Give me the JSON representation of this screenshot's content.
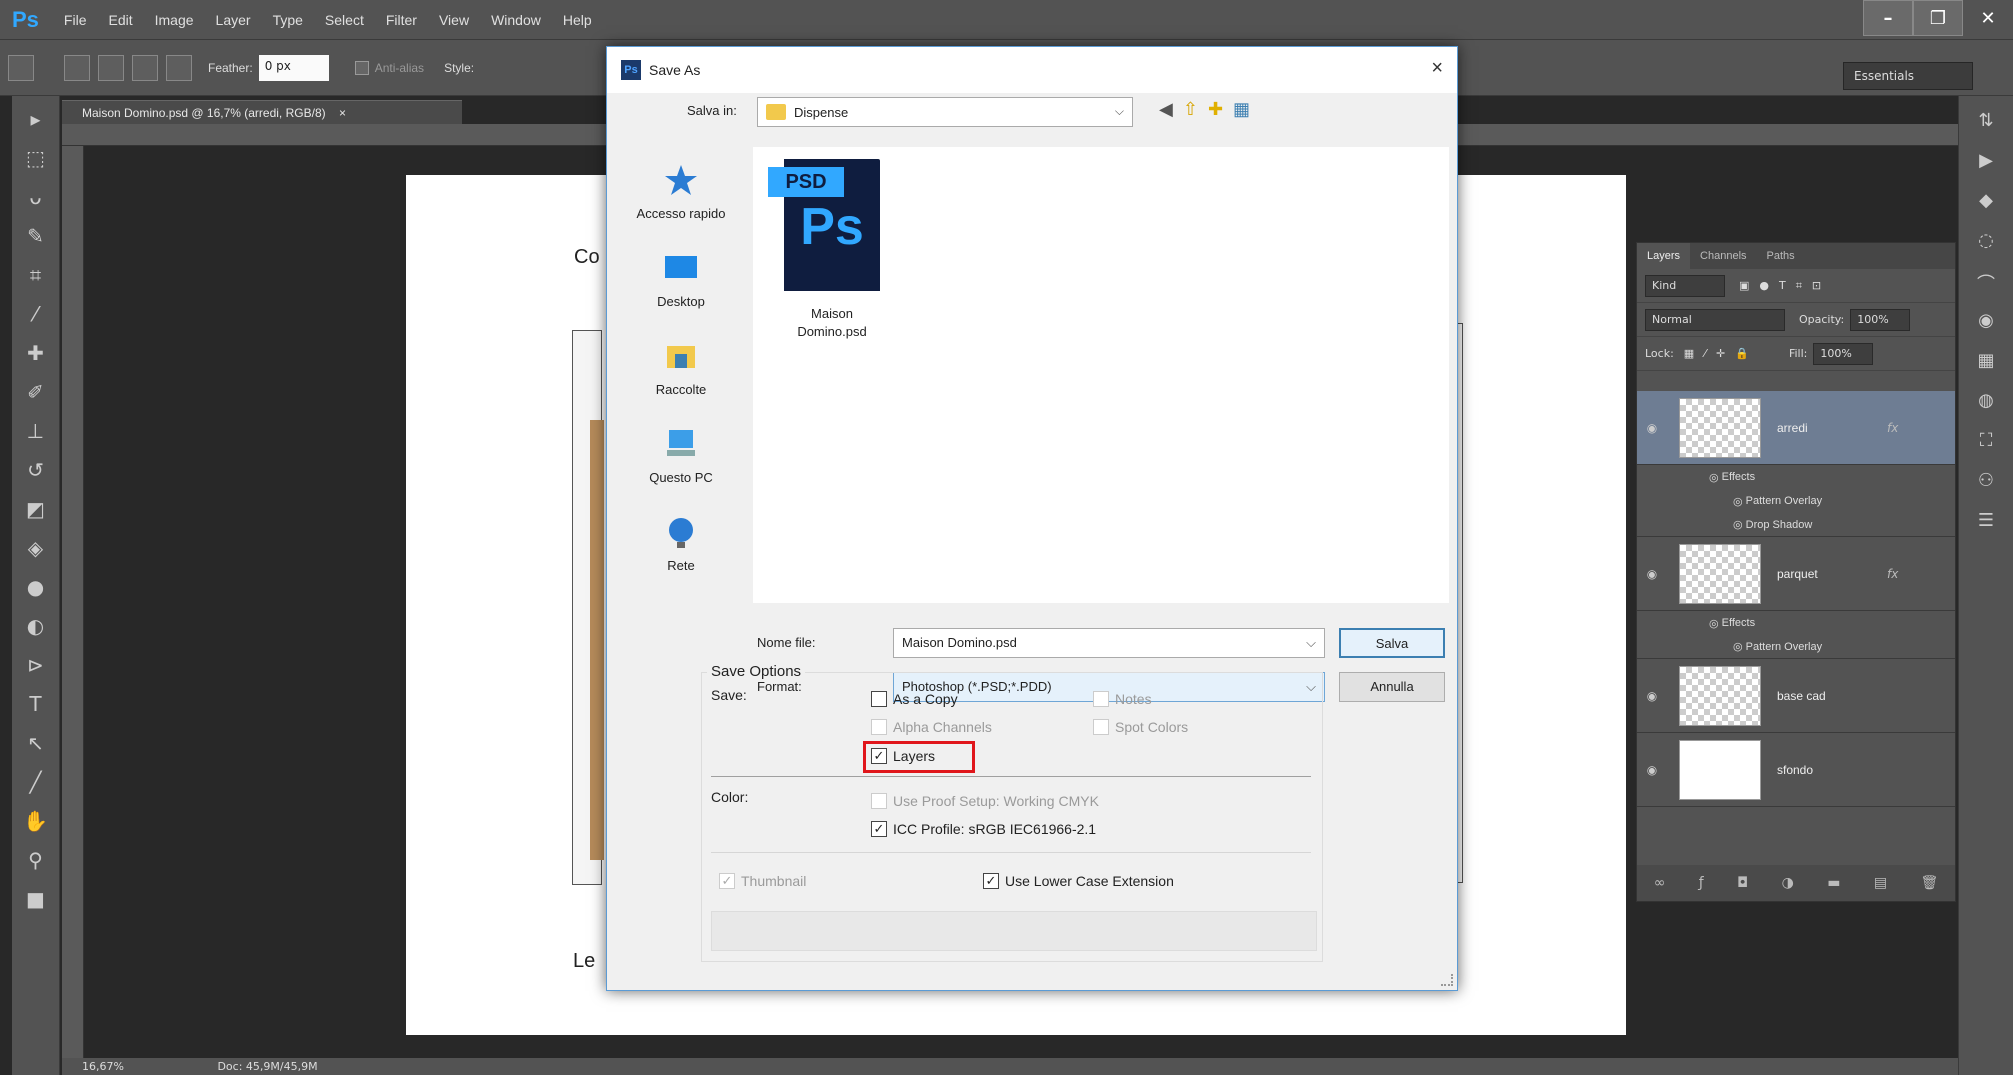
{
  "app": {
    "logo": "Ps"
  },
  "menu": [
    "File",
    "Edit",
    "Image",
    "Layer",
    "Type",
    "Select",
    "Filter",
    "View",
    "Window",
    "Help"
  ],
  "window_controls": {
    "minimize": "–",
    "restore": "❐",
    "close": "✕"
  },
  "options_bar": {
    "feather_label": "Feather:",
    "feather_value": "0 px",
    "antialias_label": "Anti-alias",
    "style_label": "Style:",
    "workspace": "Essentials"
  },
  "document_tab": {
    "title": "Maison Domino.psd @ 16,7% (arredi, RGB/8)",
    "close": "×"
  },
  "canvas": {
    "text_top": "Co",
    "text_bottom": "Le"
  },
  "status_bar": {
    "zoom": "16,67%",
    "doc": "Doc: 45,9M/45,9M"
  },
  "layers_panel": {
    "tabs": [
      "Layers",
      "Channels",
      "Paths"
    ],
    "filter": "Kind",
    "blend_mode": "Normal",
    "opacity_label": "Opacity:",
    "opacity_value": "100%",
    "lock_label": "Lock:",
    "fill_label": "Fill:",
    "fill_value": "100%",
    "layers": [
      {
        "name": "arredi",
        "fx": "fx",
        "effects_label": "Effects",
        "effects": [
          "Pattern Overlay",
          "Drop Shadow"
        ]
      },
      {
        "name": "parquet",
        "fx": "fx",
        "effects_label": "Effects",
        "effects": [
          "Pattern Overlay"
        ]
      },
      {
        "name": "base cad"
      },
      {
        "name": "sfondo"
      }
    ]
  },
  "dialog": {
    "title": "Save As",
    "close": "×",
    "save_in_label": "Salva in:",
    "save_in_value": "Dispense",
    "places": [
      "Accesso rapido",
      "Desktop",
      "Raccolte",
      "Questo PC",
      "Rete"
    ],
    "file": {
      "tag": "PSD",
      "glyph": "Ps",
      "name_line1": "Maison",
      "name_line2": "Domino.psd"
    },
    "filename_label": "Nome file:",
    "filename_value": "Maison Domino.psd",
    "format_label": "Format:",
    "format_value": "Photoshop (*.PSD;*.PDD)",
    "save_button": "Salva",
    "cancel_button": "Annulla",
    "save_options_label": "Save Options",
    "save_label": "Save:",
    "options": {
      "as_a_copy": {
        "label": "As a Copy",
        "checked": false,
        "enabled": true
      },
      "notes": {
        "label": "Notes",
        "checked": false,
        "enabled": false
      },
      "alpha_channels": {
        "label": "Alpha Channels",
        "checked": false,
        "enabled": false
      },
      "spot_colors": {
        "label": "Spot Colors",
        "checked": false,
        "enabled": false
      },
      "layers": {
        "label": "Layers",
        "checked": true,
        "enabled": true
      }
    },
    "color_label": "Color:",
    "color_options": {
      "use_proof_setup": {
        "label": "Use Proof Setup:  Working CMYK",
        "checked": false,
        "enabled": false
      },
      "icc_profile": {
        "label": "ICC Profile:  sRGB IEC61966-2.1",
        "checked": true,
        "enabled": true
      }
    },
    "thumbnail": {
      "label": "Thumbnail",
      "checked": true,
      "enabled": false
    },
    "lower_case": {
      "label": "Use Lower Case Extension",
      "checked": true,
      "enabled": true
    }
  },
  "colors": {
    "ps_blue": "#31a8ff",
    "highlight": "#e0161b",
    "selected_layer": "#6e7d93"
  }
}
